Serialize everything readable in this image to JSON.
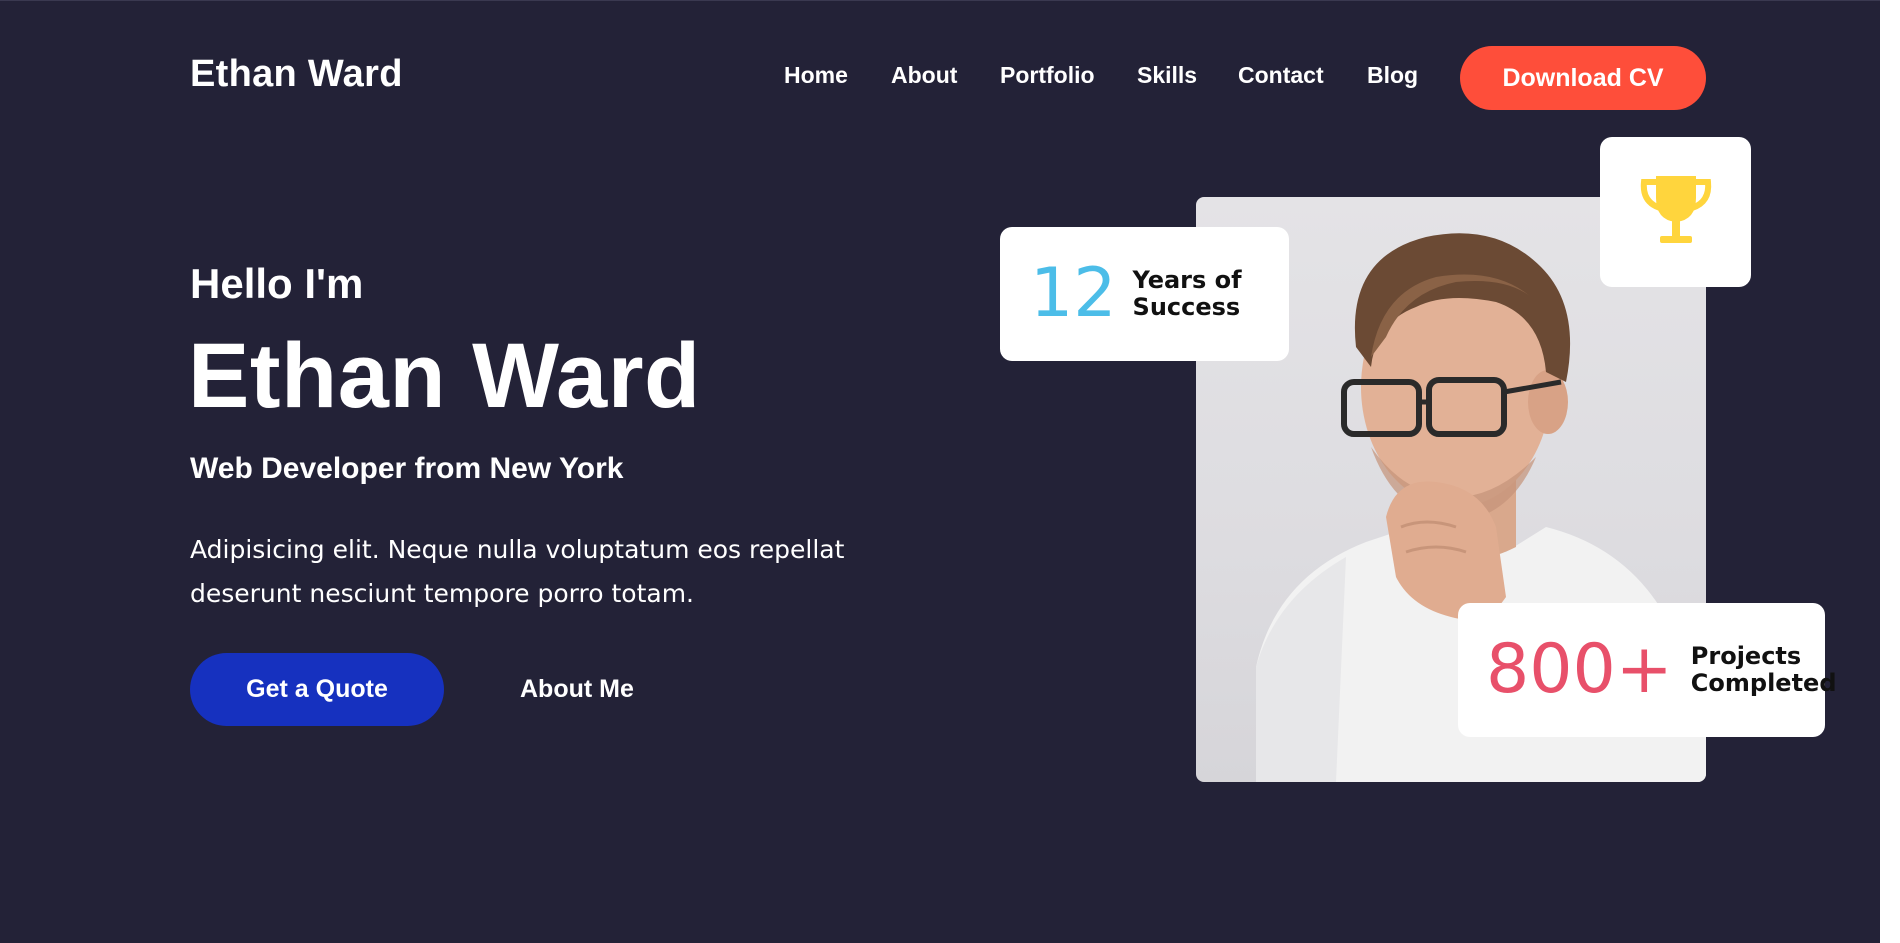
{
  "header": {
    "logo": "Ethan Ward",
    "nav": [
      "Home",
      "About",
      "Portfolio",
      "Skills",
      "Contact",
      "Blog"
    ],
    "cta_label": "Download CV"
  },
  "hero": {
    "greeting": "Hello I'm",
    "name": "Ethan Ward",
    "role": "Web Developer from New York",
    "description": "Adipisicing elit. Neque nulla voluptatum eos repellat deserunt nesciunt tempore porro totam.",
    "primary_button": "Get a Quote",
    "secondary_link": "About Me"
  },
  "stats": {
    "years": {
      "value": "12",
      "label_line1": "Years of",
      "label_line2": "Success"
    },
    "projects": {
      "value": "800+",
      "label_line1": "Projects",
      "label_line2": "Completed"
    }
  },
  "icons": {
    "trophy": "trophy-icon"
  },
  "colors": {
    "background": "#232237",
    "accent_cta": "#fe4e3a",
    "primary_button": "#1631bf",
    "years_number": "#4cbde8",
    "projects_number": "#e8506a",
    "trophy": "#ffd53d"
  }
}
